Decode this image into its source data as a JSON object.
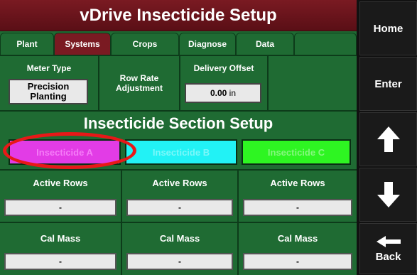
{
  "title": "vDrive Insecticide Setup",
  "tabs": [
    {
      "label": "Plant",
      "active": false
    },
    {
      "label": "Systems",
      "active": true
    },
    {
      "label": "Crops",
      "active": false
    },
    {
      "label": "Diagnose",
      "active": false
    },
    {
      "label": "Data",
      "active": false
    },
    {
      "label": "",
      "active": false
    }
  ],
  "system": {
    "meter_type_label": "Meter Type",
    "meter_type_value_line1": "Precision",
    "meter_type_value_line2": "Planting",
    "row_rate_line1": "Row Rate",
    "row_rate_line2": "Adjustment",
    "delivery_offset_label": "Delivery Offset",
    "delivery_offset_value": "0.00",
    "delivery_offset_unit": "in"
  },
  "section_title": "Insecticide Section Setup",
  "insecticides": [
    {
      "label": "Insecticide A",
      "bg": "#e23ce6",
      "fg": "#f57cf7"
    },
    {
      "label": "Insecticide B",
      "bg": "#22f2f5",
      "fg": "#7cf7f9"
    },
    {
      "label": "Insecticide C",
      "bg": "#2ef522",
      "fg": "#86f77f"
    }
  ],
  "active_rows": {
    "label": "Active Rows",
    "values": [
      "-",
      "-",
      "-"
    ]
  },
  "cal_mass": {
    "label": "Cal Mass",
    "values": [
      "-",
      "-",
      "-"
    ]
  },
  "side": {
    "home": "Home",
    "enter": "Enter",
    "back": "Back"
  },
  "colors": {
    "title_bg": "#7a1a22",
    "panel_green": "#1f6b33",
    "highlight": "#e81818"
  }
}
